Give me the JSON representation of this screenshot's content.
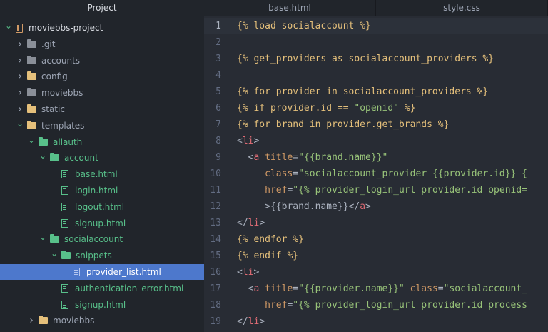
{
  "sidebar": {
    "header": "Project",
    "items": [
      {
        "label": "moviebbs-project",
        "type": "project",
        "open": true,
        "indent": 0
      },
      {
        "label": ".git",
        "type": "folder",
        "color": "gray",
        "open": false,
        "indent": 1
      },
      {
        "label": "accounts",
        "type": "folder",
        "color": "gray",
        "open": false,
        "indent": 1
      },
      {
        "label": "config",
        "type": "folder",
        "color": "yellow",
        "open": false,
        "indent": 1
      },
      {
        "label": "moviebbs",
        "type": "folder",
        "color": "gray",
        "open": false,
        "indent": 1
      },
      {
        "label": "static",
        "type": "folder",
        "color": "yellow",
        "open": false,
        "indent": 1
      },
      {
        "label": "templates",
        "type": "folder",
        "color": "yellow",
        "open": true,
        "indent": 1
      },
      {
        "label": "allauth",
        "type": "folder",
        "color": "green",
        "open": true,
        "indent": 2
      },
      {
        "label": "account",
        "type": "folder",
        "color": "green",
        "open": true,
        "indent": 3
      },
      {
        "label": "base.html",
        "type": "file",
        "indent": 4
      },
      {
        "label": "login.html",
        "type": "file",
        "indent": 4
      },
      {
        "label": "logout.html",
        "type": "file",
        "indent": 4
      },
      {
        "label": "signup.html",
        "type": "file",
        "indent": 4
      },
      {
        "label": "socialaccount",
        "type": "folder",
        "color": "green",
        "open": true,
        "indent": 3
      },
      {
        "label": "snippets",
        "type": "folder",
        "color": "green",
        "open": true,
        "indent": 4
      },
      {
        "label": "provider_list.html",
        "type": "file",
        "indent": 5,
        "selected": true
      },
      {
        "label": "authentication_error.html",
        "type": "file",
        "indent": 4
      },
      {
        "label": "signup.html",
        "type": "file",
        "indent": 4
      },
      {
        "label": "moviebbs",
        "type": "folder",
        "color": "yellow",
        "open": false,
        "indent": 2
      }
    ]
  },
  "tabs": [
    {
      "label": "base.html",
      "active": false
    },
    {
      "label": "style.css",
      "active": false
    }
  ],
  "code": {
    "current_line": 1,
    "lines": [
      {
        "n": "1",
        "tokens": [
          [
            "tpl",
            "{% load socialaccount %}"
          ]
        ]
      },
      {
        "n": "2",
        "tokens": []
      },
      {
        "n": "3",
        "tokens": [
          [
            "tpl",
            "{% get_providers as socialaccount_providers %}"
          ]
        ]
      },
      {
        "n": "4",
        "tokens": []
      },
      {
        "n": "5",
        "tokens": [
          [
            "tpl",
            "{% for provider in socialaccount_providers %}"
          ]
        ]
      },
      {
        "n": "6",
        "tokens": [
          [
            "tpl",
            "{% if provider.id == "
          ],
          [
            "str",
            "\"openid\""
          ],
          [
            "tpl",
            " %}"
          ]
        ]
      },
      {
        "n": "7",
        "tokens": [
          [
            "tpl",
            "{% for brand in provider.get_brands %}"
          ]
        ]
      },
      {
        "n": "8",
        "tokens": [
          [
            "txt",
            "<"
          ],
          [
            "tag",
            "li"
          ],
          [
            "txt",
            ">"
          ]
        ]
      },
      {
        "n": "9",
        "tokens": [
          [
            "txt",
            "  <"
          ],
          [
            "tag",
            "a"
          ],
          [
            "txt",
            " "
          ],
          [
            "attr",
            "title"
          ],
          [
            "txt",
            "="
          ],
          [
            "str",
            "\"{{brand.name}}\""
          ]
        ]
      },
      {
        "n": "10",
        "tokens": [
          [
            "txt",
            "     "
          ],
          [
            "attr",
            "class"
          ],
          [
            "txt",
            "="
          ],
          [
            "str",
            "\"socialaccount_provider {{provider.id}} {"
          ]
        ]
      },
      {
        "n": "11",
        "tokens": [
          [
            "txt",
            "     "
          ],
          [
            "attr",
            "href"
          ],
          [
            "txt",
            "="
          ],
          [
            "str",
            "\"{% provider_login_url provider.id openid="
          ]
        ]
      },
      {
        "n": "12",
        "tokens": [
          [
            "txt",
            "     >{{brand.name}}</"
          ],
          [
            "tag",
            "a"
          ],
          [
            "txt",
            ">"
          ]
        ]
      },
      {
        "n": "13",
        "tokens": [
          [
            "txt",
            "</"
          ],
          [
            "tag",
            "li"
          ],
          [
            "txt",
            ">"
          ]
        ]
      },
      {
        "n": "14",
        "tokens": [
          [
            "tpl",
            "{% endfor %}"
          ]
        ]
      },
      {
        "n": "15",
        "tokens": [
          [
            "tpl",
            "{% endif %}"
          ]
        ]
      },
      {
        "n": "16",
        "tokens": [
          [
            "txt",
            "<"
          ],
          [
            "tag",
            "li"
          ],
          [
            "txt",
            ">"
          ]
        ]
      },
      {
        "n": "17",
        "tokens": [
          [
            "txt",
            "  <"
          ],
          [
            "tag",
            "a"
          ],
          [
            "txt",
            " "
          ],
          [
            "attr",
            "title"
          ],
          [
            "txt",
            "="
          ],
          [
            "str",
            "\"{{provider.name}}\""
          ],
          [
            "txt",
            " "
          ],
          [
            "attr",
            "class"
          ],
          [
            "txt",
            "="
          ],
          [
            "str",
            "\"socialaccount_"
          ]
        ]
      },
      {
        "n": "18",
        "tokens": [
          [
            "txt",
            "     "
          ],
          [
            "attr",
            "href"
          ],
          [
            "txt",
            "="
          ],
          [
            "str",
            "\"{% provider_login_url provider.id process"
          ]
        ]
      },
      {
        "n": "19",
        "tokens": [
          [
            "txt",
            "</"
          ],
          [
            "tag",
            "li"
          ],
          [
            "txt",
            ">"
          ]
        ]
      }
    ]
  },
  "colors": {
    "accent": "#4d78cc",
    "folder_gray": "#8a8f98",
    "folder_yellow": "#e5c07b",
    "folder_green": "#58c08a"
  }
}
